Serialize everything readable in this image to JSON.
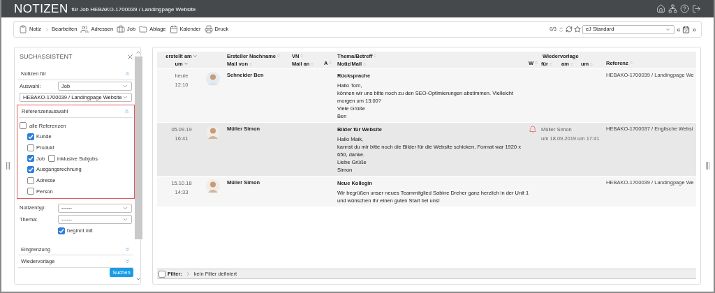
{
  "window": {
    "title": "NOTIZEN",
    "subtitle": "für Job HEBAKO-1700039 / Landingpage Website"
  },
  "toolbar": {
    "items": [
      {
        "kind": "clipboard",
        "label": "Notiz"
      },
      {
        "kind": "chevron",
        "label": "Bearbeiten"
      },
      {
        "kind": "users",
        "label": "Adressen"
      },
      {
        "kind": "briefcase",
        "label": "Job"
      },
      {
        "kind": "folder",
        "label": "Ablage"
      },
      {
        "kind": "calendar",
        "label": "Kalender"
      },
      {
        "kind": "printer",
        "label": "Druck"
      }
    ],
    "counter": "0/3",
    "view_select": "eJ Standard",
    "prev": "«",
    "next": "»"
  },
  "search_panel": {
    "title": "SUCHASSISTENT",
    "notes_for": {
      "title": "Notizen für",
      "expanded": true
    },
    "selection_label": "Auswahl:",
    "selection_value": "Job",
    "object_value": "HEBAKO-1700039 / Landingpage Website",
    "references": {
      "title": "Referenzenauswahl",
      "expanded": true,
      "all": {
        "label": "alle Referenzen",
        "checked": false
      },
      "items": [
        {
          "label": "Kunde",
          "checked": true
        },
        {
          "label": "Produkt",
          "checked": false
        },
        {
          "label": "Job",
          "checked": true,
          "sub": {
            "label": "inklusive Subjobs",
            "checked": false
          }
        },
        {
          "label": "Ausgangsrechnung",
          "checked": true
        },
        {
          "label": "Adresse",
          "checked": false
        },
        {
          "label": "Person",
          "checked": false
        }
      ]
    },
    "note_type_label": "Notizentyp:",
    "note_type_value": "------",
    "topic_label": "Thema:",
    "topic_value": "------",
    "begins_with": {
      "label": "beginnt mit",
      "checked": true
    },
    "sections": [
      {
        "title": "Eingrenzung",
        "expanded": false
      },
      {
        "title": "Wiedervorlage",
        "expanded": false
      }
    ],
    "search_button": "Suchen"
  },
  "table": {
    "header": {
      "created": {
        "label": "erstellt am",
        "sorted": true
      },
      "created_time": {
        "label": "um",
        "sorted": true
      },
      "author": {
        "label": "Ersteller Nachname",
        "sorted": false
      },
      "mail_from": {
        "label": "Mail von",
        "sorted": false
      },
      "first_name": {
        "label": "VN",
        "sorted": false
      },
      "mail_to": {
        "label": "Mail an",
        "sorted": false
      },
      "a": {
        "label": "A",
        "sorted": false
      },
      "subject": {
        "label": "Thema/Betreff",
        "sorted": false
      },
      "note": {
        "label": "Notiz/Mail",
        "sorted": false
      },
      "w": {
        "label": "W",
        "sorted": false
      },
      "followup": {
        "label": "Wiedervorlage"
      },
      "followup_for": {
        "label": "für",
        "sorted": false
      },
      "followup_on": {
        "label": "am",
        "sorted": false
      },
      "followup_at": {
        "label": "um",
        "sorted": false
      },
      "reference": {
        "label": "Referenz",
        "sorted": false
      }
    },
    "rows": [
      {
        "date": "heute",
        "time": "12:10",
        "author": "Schneider Ben",
        "subject": "Rücksprache",
        "selected": false,
        "lines": [
          "Hallo Tom,",
          "können wir uns bitte noch zu den SEO-Optimierungen abstimmen. Vielleicht",
          "morgen um 13:00?",
          "Viele Grüße",
          "Ben"
        ],
        "reference": "HEBAKO-1700039 / Landingpage We"
      },
      {
        "date": "05.09.19",
        "time": "16:41",
        "author": "Müller Simon",
        "subject": "Bilder für Website",
        "selected": true,
        "lines": [
          "Hallo Maik,",
          "kannst du mir bitte noch die Bilder für die Website schicken, Format war 1920 x",
          "650, danke.",
          "Liebe Grüße",
          "Simon"
        ],
        "reminder": {
          "for": "Müller Simon",
          "when": "um 18.09.2019 um 17:41"
        },
        "reference": "HEBAKO-1700037 / Englische Websi"
      },
      {
        "date": "15.10.18",
        "time": "14:33",
        "author": "Müller Simon",
        "subject": "Neue Kollegin",
        "selected": false,
        "lines": [
          "Wir begrüßen unser neues Teammitglied Sabine Dreher ganz herzlich in der Unit 1",
          "und wünschen Ihr einen guten Start bei uns!"
        ],
        "reference": "HEBAKO-1700039 / Landingpage We"
      }
    ]
  },
  "filter_bar": {
    "checked": false,
    "label": "Filter:",
    "value": "kein Filter definiert"
  }
}
